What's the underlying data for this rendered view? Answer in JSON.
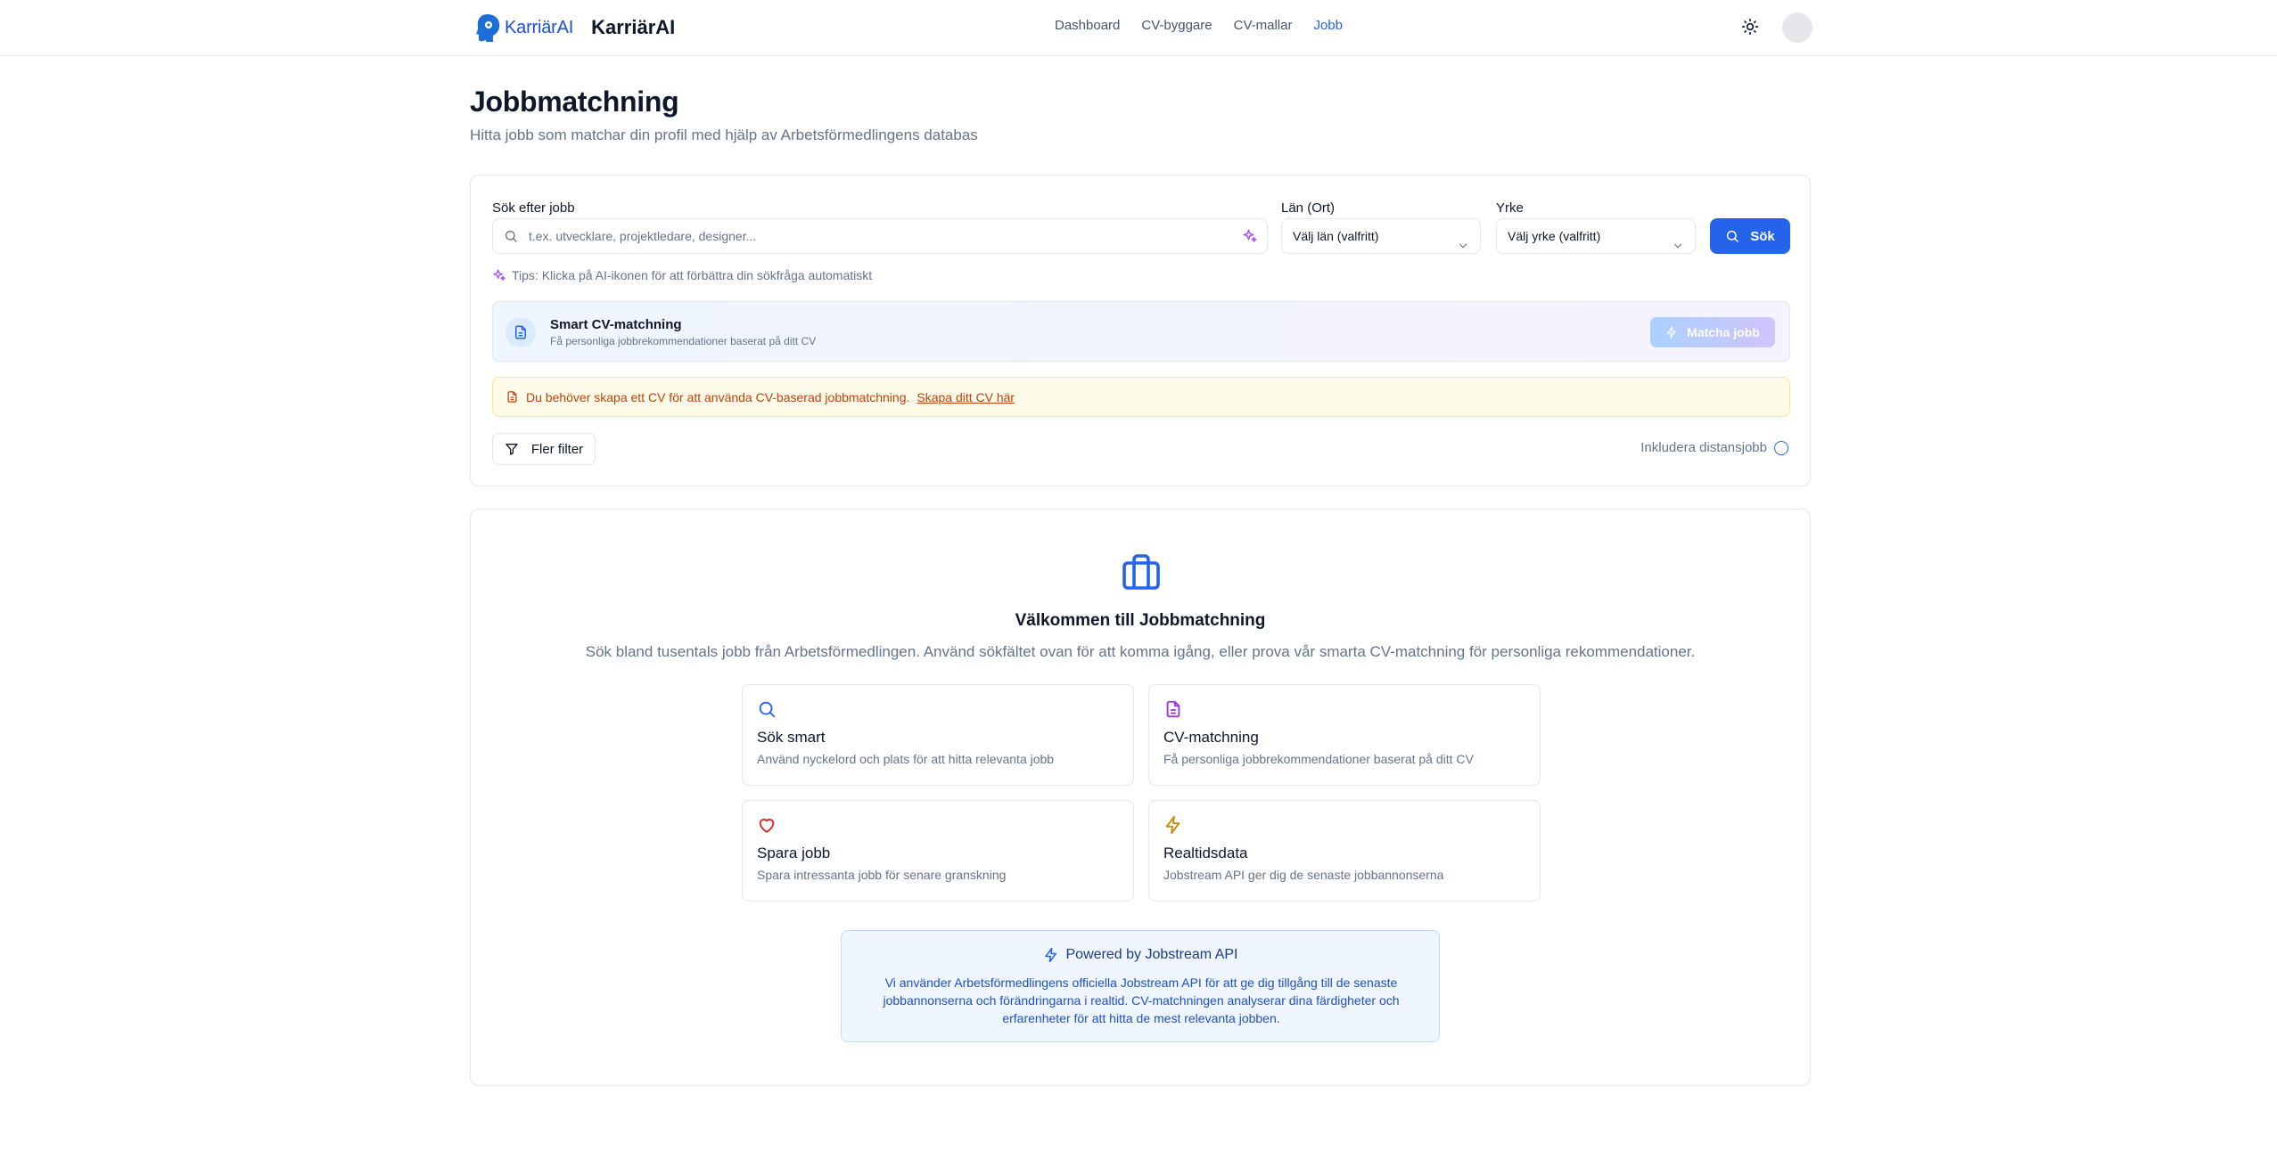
{
  "header": {
    "logo_text": "KarriärAI",
    "brand_name": "KarriärAI",
    "nav": [
      {
        "label": "Dashboard",
        "active": false
      },
      {
        "label": "CV-byggare",
        "active": false
      },
      {
        "label": "CV-mallar",
        "active": false
      },
      {
        "label": "Jobb",
        "active": true
      }
    ],
    "theme_icon": "sun-icon",
    "accent_color": "#2563eb"
  },
  "page": {
    "title": "Jobbmatchning",
    "subtitle": "Hitta jobb som matchar din profil med hjälp av Arbetsförmedlingens databas"
  },
  "search": {
    "query_label": "Sök efter jobb",
    "query_placeholder": "t.ex. utvecklare, projektledare, designer...",
    "query_value": "",
    "region_label": "Län (Ort)",
    "region_value": "Välj län (valfritt)",
    "occupation_label": "Yrke",
    "occupation_value": "Välj yrke (valfritt)",
    "search_button": "Sök",
    "tip": "Tips: Klicka på AI-ikonen för att förbättra din sökfråga automatiskt"
  },
  "smart_match": {
    "title": "Smart CV-matchning",
    "subtitle": "Få personliga jobbrekommendationer baserat på ditt CV",
    "button": "Matcha jobb",
    "button_disabled": true
  },
  "warning": {
    "text": "Du behöver skapa ett CV för att använda CV-baserad jobbmatchning.",
    "link": "Skapa ditt CV här",
    "color": "#c2410c"
  },
  "filters": {
    "more_filters": "Fler filter",
    "remote_label": "Inkludera distansjobb",
    "remote_checked": false
  },
  "welcome": {
    "title": "Välkommen till Jobbmatchning",
    "text": "Sök bland tusentals jobb från Arbetsförmedlingen. Använd sökfältet ovan för att komma igång, eller prova vår smarta CV-matchning för personliga rekommendationer.",
    "features": [
      {
        "icon": "search-icon",
        "color": "#2563eb",
        "title": "Sök smart",
        "desc": "Använd nyckelord och plats för att hitta relevanta jobb"
      },
      {
        "icon": "document-icon",
        "color": "#9333ea",
        "title": "CV-matchning",
        "desc": "Få personliga jobbrekommendationer baserat på ditt CV"
      },
      {
        "icon": "heart-icon",
        "color": "#dc2626",
        "title": "Spara jobb",
        "desc": "Spara intressanta jobb för senare granskning"
      },
      {
        "icon": "lightning-icon",
        "color": "#ca8a04",
        "title": "Realtidsdata",
        "desc": "Jobstream API ger dig de senaste jobbannonserna"
      }
    ],
    "powered_title": "Powered by Jobstream API",
    "powered_text": "Vi använder Arbetsförmedlingens officiella Jobstream API för att ge dig tillgång till de senaste jobbannonserna och förändringarna i realtid. CV-matchningen analyserar dina färdigheter och erfarenheter för att hitta de mest relevanta jobben."
  }
}
